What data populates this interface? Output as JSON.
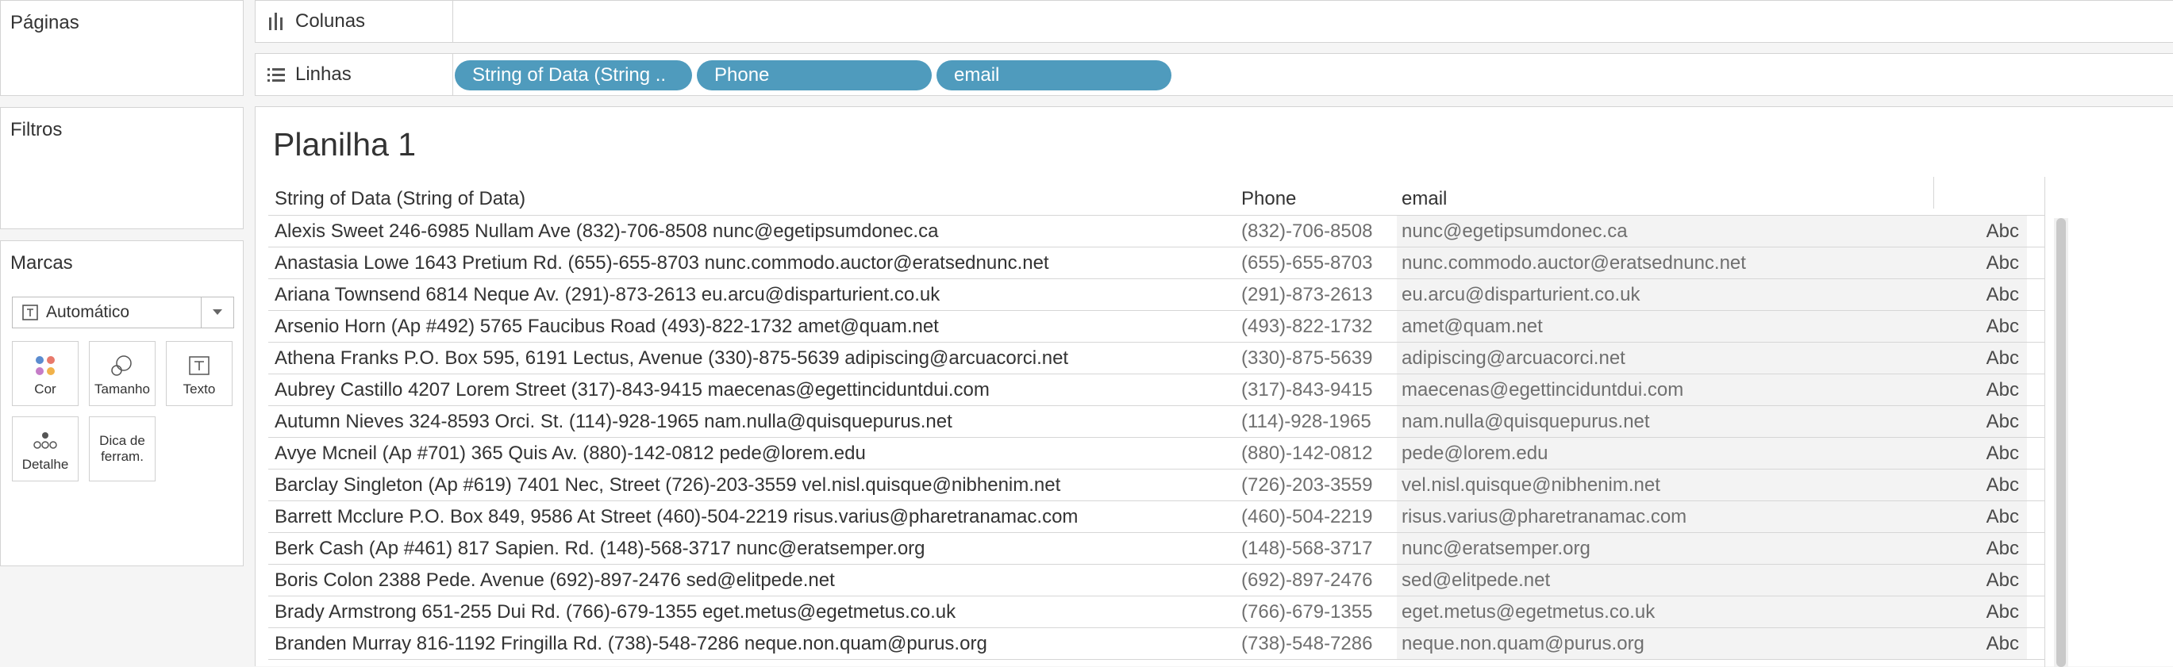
{
  "left_panels": {
    "pages_title": "Páginas",
    "filters_title": "Filtros",
    "marks_title": "Marcas",
    "mark_type": "Automático",
    "mark_buttons": {
      "color": "Cor",
      "size": "Tamanho",
      "text": "Texto",
      "detail": "Detalhe",
      "tooltip_line1": "Dica de",
      "tooltip_line2": "ferram."
    }
  },
  "shelves": {
    "columns_label": "Colunas",
    "rows_label": "Linhas",
    "row_pills": [
      "String of Data (String ..",
      "Phone",
      "email"
    ]
  },
  "sheet": {
    "title": "Planilha 1",
    "headers": [
      "String of Data (String of Data)",
      "Phone",
      "email"
    ],
    "rows": [
      {
        "text": "Alexis Sweet  246-6985 Nullam Ave (832)-706-8508 nunc@egetipsumdonec.ca",
        "phone": "(832)-706-8508",
        "email": "nunc@egetipsumdonec.ca",
        "mark": "Abc"
      },
      {
        "text": "Anastasia Lowe  1643 Pretium Rd. (655)-655-8703 nunc.commodo.auctor@eratsednunc.net",
        "phone": "(655)-655-8703",
        "email": "nunc.commodo.auctor@eratsednunc.net",
        "mark": "Abc"
      },
      {
        "text": "Ariana Townsend  6814 Neque Av. (291)-873-2613 eu.arcu@disparturient.co.uk",
        "phone": "(291)-873-2613",
        "email": "eu.arcu@disparturient.co.uk",
        "mark": "Abc"
      },
      {
        "text": "Arsenio Horn  (Ap #492) 5765 Faucibus Road (493)-822-1732 amet@quam.net",
        "phone": "(493)-822-1732",
        "email": "amet@quam.net",
        "mark": "Abc"
      },
      {
        "text": "Athena Franks  P.O. Box 595, 6191 Lectus, Avenue (330)-875-5639 adipiscing@arcuacorci.net",
        "phone": "(330)-875-5639",
        "email": "adipiscing@arcuacorci.net",
        "mark": "Abc"
      },
      {
        "text": "Aubrey Castillo  4207 Lorem Street (317)-843-9415 maecenas@egettinciduntdui.com",
        "phone": "(317)-843-9415",
        "email": "maecenas@egettinciduntdui.com",
        "mark": "Abc"
      },
      {
        "text": "Autumn Nieves  324-8593 Orci. St. (114)-928-1965 nam.nulla@quisquepurus.net",
        "phone": "(114)-928-1965",
        "email": "nam.nulla@quisquepurus.net",
        "mark": "Abc"
      },
      {
        "text": "Avye Mcneil  (Ap #701) 365 Quis Av. (880)-142-0812 pede@lorem.edu",
        "phone": "(880)-142-0812",
        "email": "pede@lorem.edu",
        "mark": "Abc"
      },
      {
        "text": "Barclay Singleton  (Ap #619) 7401 Nec, Street (726)-203-3559 vel.nisl.quisque@nibhenim.net",
        "phone": "(726)-203-3559",
        "email": "vel.nisl.quisque@nibhenim.net",
        "mark": "Abc"
      },
      {
        "text": "Barrett Mcclure  P.O. Box 849, 9586 At Street (460)-504-2219 risus.varius@pharetranamac.com",
        "phone": "(460)-504-2219",
        "email": "risus.varius@pharetranamac.com",
        "mark": "Abc"
      },
      {
        "text": "Berk Cash  (Ap #461) 817 Sapien. Rd. (148)-568-3717 nunc@eratsemper.org",
        "phone": "(148)-568-3717",
        "email": "nunc@eratsemper.org",
        "mark": "Abc"
      },
      {
        "text": "Boris Colon  2388 Pede. Avenue (692)-897-2476 sed@elitpede.net",
        "phone": "(692)-897-2476",
        "email": "sed@elitpede.net",
        "mark": "Abc"
      },
      {
        "text": "Brady Armstrong  651-255 Dui Rd. (766)-679-1355 eget.metus@egetmetus.co.uk",
        "phone": "(766)-679-1355",
        "email": "eget.metus@egetmetus.co.uk",
        "mark": "Abc"
      },
      {
        "text": "Branden Murray  816-1192 Fringilla Rd. (738)-548-7286 neque.non.quam@purus.org",
        "phone": "(738)-548-7286",
        "email": "neque.non.quam@purus.org",
        "mark": "Abc"
      }
    ]
  },
  "colors": {
    "pill": "#4f9bbd",
    "background": "#f5f5f5",
    "alt_row": "#f3f3f3"
  }
}
